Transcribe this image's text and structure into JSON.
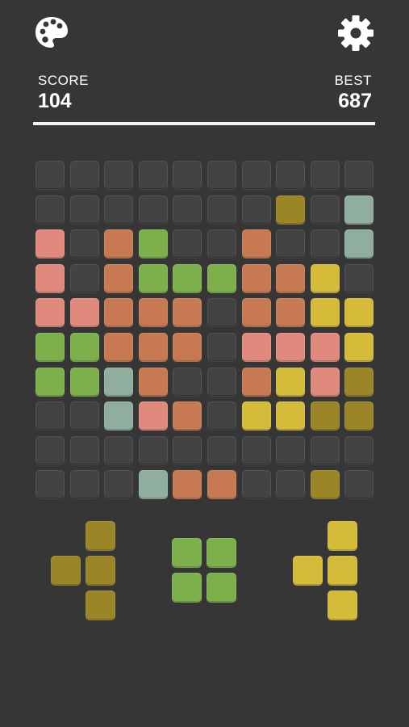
{
  "header": {
    "palette_icon": "palette-icon",
    "settings_icon": "gear-icon",
    "score_label": "SCORE",
    "score_value": "104",
    "best_label": "BEST",
    "best_value": "687"
  },
  "colors": {
    "background": "#363636",
    "empty": "#434343",
    "R": "#e08a7e",
    "O": "#c77a52",
    "G": "#7db04b",
    "T": "#8fae9d",
    "Y": "#d4bc3a",
    "K": "#9a8527"
  },
  "board": {
    "rows": 10,
    "cols": 10,
    "cells": [
      "..........",
      ".......K.T",
      "R.OG..O..T",
      "R.OGGGOOY.",
      "RROOO.OOYY",
      "GGOOO.RRRY",
      "GGTO..OYRK",
      "..TRO.YYKK",
      "..........",
      "...TOO..K."
    ]
  },
  "pieces": [
    {
      "color": "K",
      "cells": [
        [
          0,
          1
        ],
        [
          1,
          0
        ],
        [
          1,
          1
        ],
        [
          2,
          1
        ]
      ]
    },
    {
      "color": "G",
      "cells": [
        [
          0,
          0
        ],
        [
          0,
          1
        ],
        [
          1,
          0
        ],
        [
          1,
          1
        ]
      ]
    },
    {
      "color": "Y",
      "cells": [
        [
          0,
          1
        ],
        [
          1,
          0
        ],
        [
          1,
          1
        ],
        [
          2,
          1
        ]
      ]
    }
  ]
}
